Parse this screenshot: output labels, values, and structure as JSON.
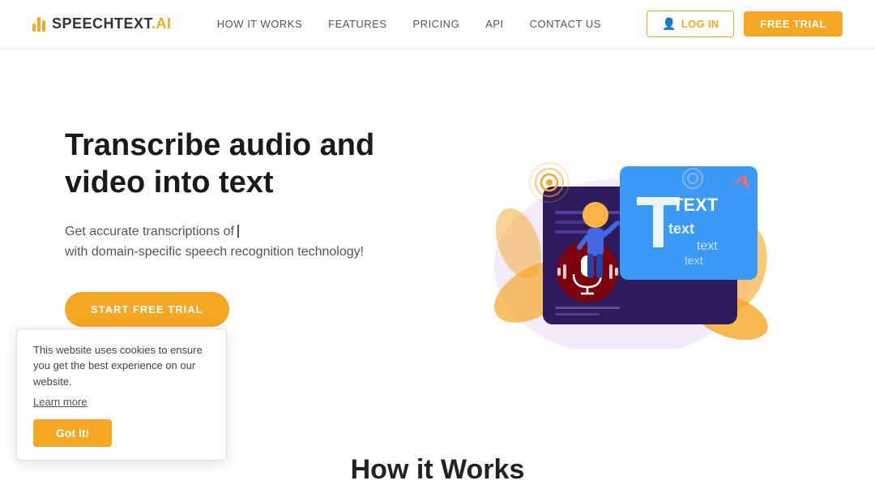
{
  "brand": {
    "name_part1": "SPEECHTEXT",
    "name_part2": ".AI"
  },
  "nav": {
    "links": [
      {
        "label": "HOW IT WORKS",
        "href": "#"
      },
      {
        "label": "FEATURES",
        "href": "#"
      },
      {
        "label": "PRICING",
        "href": "#"
      },
      {
        "label": "API",
        "href": "#"
      },
      {
        "label": "CONTACT US",
        "href": "#"
      }
    ],
    "login_label": "LOG IN",
    "free_trial_label": "FREE TRIAL"
  },
  "hero": {
    "title": "Transcribe audio and video into text",
    "subtitle_line1": "Get accurate transcriptions of ",
    "subtitle_line2": "with domain-specific speech recognition technology!",
    "cta_label": "START FREE TRIAL"
  },
  "cookie": {
    "message": "This website uses cookies to ensure you get the best experience on our website.",
    "learn_more": "Learn more",
    "accept_label": "Got it!"
  },
  "how_it_works": {
    "title": "How it Works"
  }
}
